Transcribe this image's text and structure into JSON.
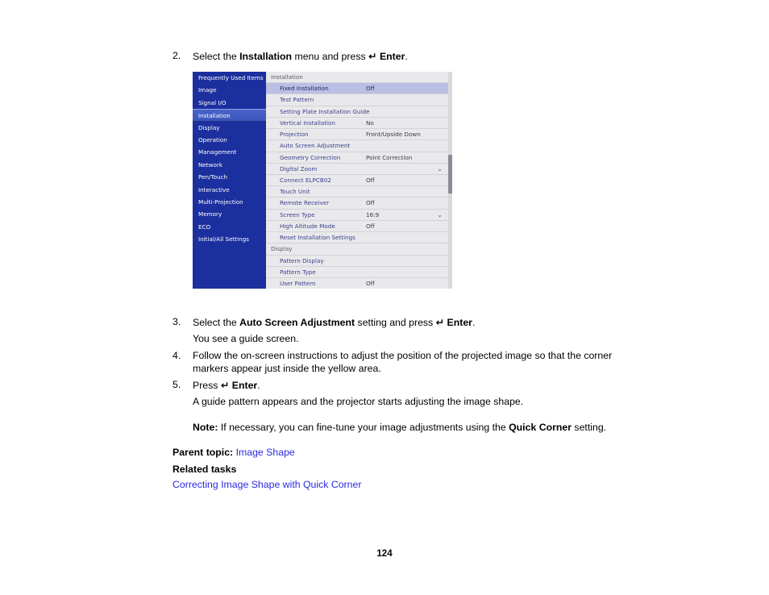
{
  "document": {
    "page_number": "124",
    "steps": [
      {
        "number": "2.",
        "text_parts": [
          {
            "t": "Select the ",
            "style": "normal"
          },
          {
            "t": "Installation",
            "style": "bold"
          },
          {
            "t": " menu and press ",
            "style": "normal"
          },
          {
            "t": "↵",
            "style": "glyph"
          },
          {
            "t": " Enter",
            "style": "bold"
          },
          {
            "t": ".",
            "style": "normal"
          }
        ]
      },
      {
        "number": "3.",
        "text_parts": [
          {
            "t": "Select the ",
            "style": "normal"
          },
          {
            "t": "Auto Screen Adjustment",
            "style": "bold"
          },
          {
            "t": " setting and press ",
            "style": "normal"
          },
          {
            "t": "↵",
            "style": "glyph"
          },
          {
            "t": " Enter",
            "style": "bold"
          },
          {
            "t": ".",
            "style": "normal"
          }
        ]
      },
      {
        "number": "4.",
        "text_parts": [
          {
            "t": "Follow the on-screen instructions to adjust the position of the projected image so that the corner markers appear just inside the yellow area.",
            "style": "normal"
          }
        ]
      },
      {
        "number": "5.",
        "text_parts": [
          {
            "t": "Press ",
            "style": "normal"
          },
          {
            "t": "↵",
            "style": "glyph"
          },
          {
            "t": " Enter",
            "style": "bold"
          },
          {
            "t": ".",
            "style": "normal"
          }
        ]
      }
    ],
    "step2_label": "2.",
    "step2_a": "Select the ",
    "step2_b": "Installation",
    "step2_c": " menu and press ",
    "step2_enter": "↵",
    "step2_d": " Enter",
    "step2_e": ".",
    "step3_label": "3.",
    "step3_a": "Select the ",
    "step3_b": "Auto Screen Adjustment",
    "step3_c": " setting and press ",
    "step3_enter": "↵",
    "step3_d": " Enter",
    "step3_e": ".",
    "step3_result": "You see a guide screen.",
    "step4_label": "4.",
    "step4_text": "Follow the on-screen instructions to adjust the position of the projected image so that the corner markers appear just inside the yellow area.",
    "step5_label": "5.",
    "step5_a": "Press ",
    "step5_enter": "↵",
    "step5_b": " Enter",
    "step5_c": ".",
    "step5_result": "A guide pattern appears and the projector starts adjusting the image shape.",
    "note_label": "Note:",
    "note_a": " If necessary, you can fine-tune your image adjustments using the ",
    "note_b": "Quick Corner",
    "note_c": " setting.",
    "parent_topic_label": "Parent topic:",
    "parent_topic_link": "Image Shape",
    "related_tasks_heading": "Related tasks",
    "related_task_link": "Correcting Image Shape with Quick Corner",
    "link_color": "#2a2ae0"
  },
  "osd": {
    "sidebar_bg": "#1b2f9e",
    "selected_bg": "#4a64c8",
    "row_highlight": "#b9c0e4",
    "panel_bg": "#e9e9ec",
    "sidebar": [
      {
        "label": "Frequently Used Items",
        "selected": false
      },
      {
        "label": "Image",
        "selected": false
      },
      {
        "label": "Signal I/O",
        "selected": false
      },
      {
        "label": "Installation",
        "selected": true
      },
      {
        "label": "Display",
        "selected": false
      },
      {
        "label": "Operation",
        "selected": false
      },
      {
        "label": "Management",
        "selected": false
      },
      {
        "label": "Network",
        "selected": false
      },
      {
        "label": "Pen/Touch",
        "selected": false
      },
      {
        "label": "Interactive",
        "selected": false
      },
      {
        "label": "Multi-Projection",
        "selected": false
      },
      {
        "label": "Memory",
        "selected": false
      },
      {
        "label": "ECO",
        "selected": false
      },
      {
        "label": "Initial/All Settings",
        "selected": false
      }
    ],
    "rows": [
      {
        "label": "Installation",
        "value": "",
        "section": true,
        "selected": false,
        "chevron": false
      },
      {
        "label": "Fixed Installation",
        "value": "Off",
        "section": false,
        "selected": true,
        "chevron": false
      },
      {
        "label": "Test Pattern",
        "value": "",
        "section": false,
        "selected": false,
        "chevron": false
      },
      {
        "label": "Setting Plate Installation Guide",
        "value": "",
        "section": false,
        "selected": false,
        "chevron": false
      },
      {
        "label": "Vertical Installation",
        "value": "No",
        "section": false,
        "selected": false,
        "chevron": false
      },
      {
        "label": "Projection",
        "value": "Front/Upside Down",
        "section": false,
        "selected": false,
        "chevron": false
      },
      {
        "label": "Auto Screen Adjustment",
        "value": "",
        "section": false,
        "selected": false,
        "chevron": false
      },
      {
        "label": "Geometry Correction",
        "value": "Point Correction",
        "section": false,
        "selected": false,
        "chevron": false
      },
      {
        "label": "Digital Zoom",
        "value": "",
        "section": false,
        "selected": false,
        "chevron": true
      },
      {
        "label": "Connect ELPCB02",
        "value": "Off",
        "section": false,
        "selected": false,
        "chevron": false
      },
      {
        "label": "Touch Unit",
        "value": "",
        "section": false,
        "selected": false,
        "chevron": false
      },
      {
        "label": "Remote Receiver",
        "value": "Off",
        "section": false,
        "selected": false,
        "chevron": false
      },
      {
        "label": "Screen Type",
        "value": "16:9",
        "section": false,
        "selected": false,
        "chevron": true
      },
      {
        "label": "High Altitude Mode",
        "value": "Off",
        "section": false,
        "selected": false,
        "chevron": false
      },
      {
        "label": "Reset Installation Settings",
        "value": "",
        "section": false,
        "selected": false,
        "chevron": false
      },
      {
        "label": "Display",
        "value": "",
        "section": true,
        "selected": false,
        "chevron": false
      },
      {
        "label": "Pattern Display",
        "value": "",
        "section": false,
        "selected": false,
        "chevron": false
      },
      {
        "label": "Pattern Type",
        "value": "",
        "section": false,
        "selected": false,
        "chevron": false
      },
      {
        "label": "User Pattern",
        "value": "Off",
        "section": false,
        "selected": false,
        "chevron": false
      }
    ],
    "chevron_glyph": "⌄"
  }
}
